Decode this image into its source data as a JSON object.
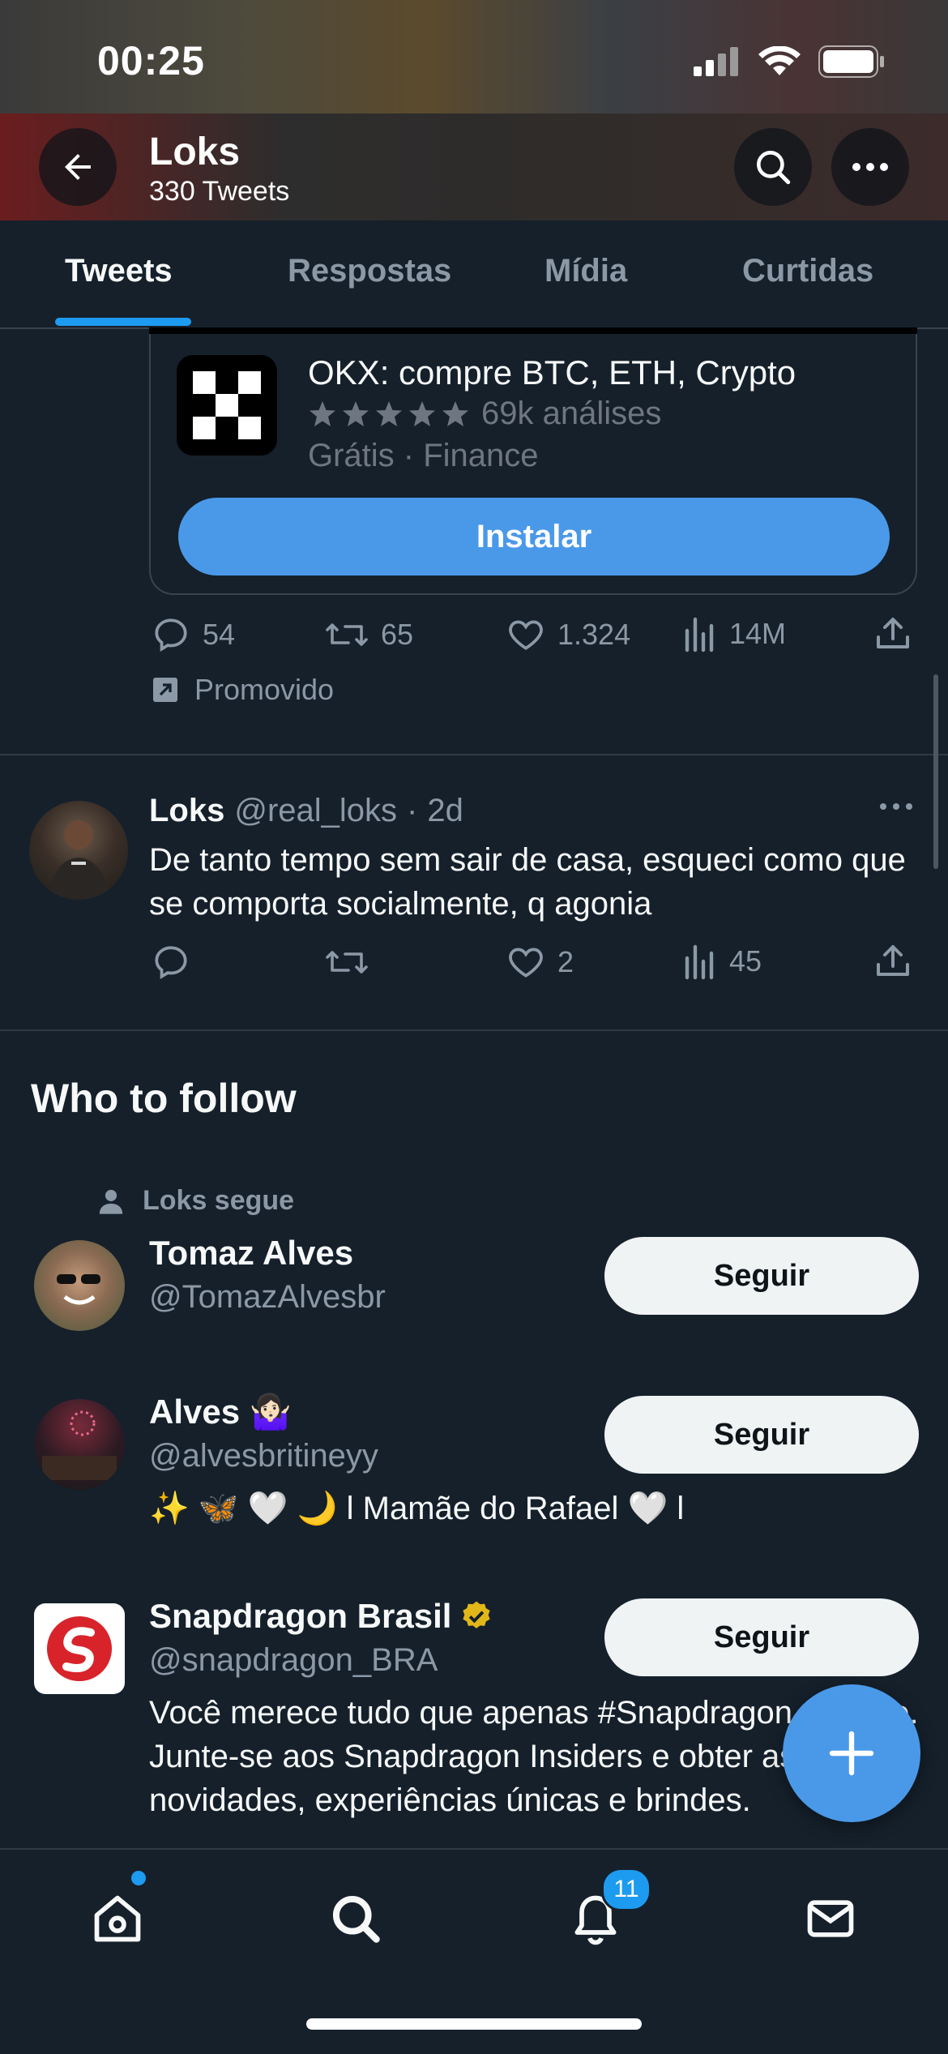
{
  "status_bar": {
    "time": "00:25"
  },
  "header": {
    "name": "Loks",
    "tweet_count": "330 Tweets"
  },
  "tabs": [
    {
      "label": "Tweets",
      "active": true
    },
    {
      "label": "Respostas",
      "active": false
    },
    {
      "label": "Mídia",
      "active": false
    },
    {
      "label": "Curtidas",
      "active": false
    }
  ],
  "ad": {
    "app_name": "OKX: compre BTC, ETH, Crypto",
    "rating_text": "69k análises",
    "meta": "Grátis · Finance",
    "install_label": "Instalar",
    "stats": {
      "replies": "54",
      "retweets": "65",
      "likes": "1.324",
      "views": "14M"
    },
    "promoted_label": "Promovido"
  },
  "tweet": {
    "name": "Loks",
    "handle": "@real_loks",
    "separator": "·",
    "age": "2d",
    "text": "De tanto tempo sem sair de casa, esqueci como que se comporta socialmente, q agonia",
    "stats": {
      "replies": "",
      "retweets": "",
      "likes": "2",
      "views": "45"
    }
  },
  "who_to_follow": {
    "title": "Who to follow",
    "context": "Loks segue",
    "follow_label": "Seguir",
    "accounts": [
      {
        "name": "Tomaz Alves",
        "handle": "@TomazAlvesbr",
        "bio": ""
      },
      {
        "name": "Alves 🤷🏻‍♀️",
        "handle": "@alvesbritineyy",
        "bio": "✨ 🦋 🤍 🌙 l Mamãe do Rafael 🤍 l"
      },
      {
        "name": "Snapdragon Brasil",
        "handle": "@snapdragon_BRA",
        "bio": "Você merece tudo que apenas #Snapdragon oferece. Junte-se aos Snapdragon Insiders e obter as últimas novidades, experiências únicas e brindes."
      }
    ]
  },
  "bottom_nav": {
    "notifications_badge": "11"
  },
  "colors": {
    "background": "#15202b",
    "accent": "#1d9bf0",
    "install_button": "#4a99e9",
    "verified_gold": "#e2b719"
  }
}
